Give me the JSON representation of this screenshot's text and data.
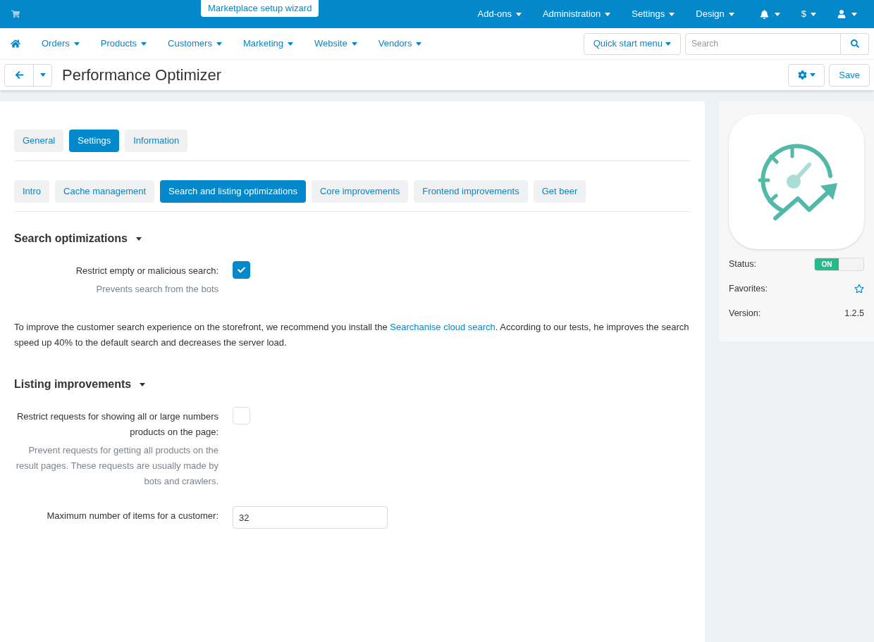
{
  "top_bar": {
    "wizard_button": "Marketplace setup wizard",
    "menus": [
      "Add-ons",
      "Administration",
      "Settings",
      "Design"
    ],
    "currency": "$"
  },
  "main_nav": {
    "items": [
      "Orders",
      "Products",
      "Customers",
      "Marketing",
      "Website",
      "Vendors"
    ],
    "quick_start": "Quick start menu",
    "search": {
      "placeholder": "Search"
    }
  },
  "toolbar": {
    "title": "Performance Optimizer",
    "save_button": "Save"
  },
  "tabs": [
    {
      "label": "General",
      "selected": false
    },
    {
      "label": "Settings",
      "selected": true
    },
    {
      "label": "Information",
      "selected": false
    }
  ],
  "subtabs": [
    {
      "label": "Intro",
      "selected": false
    },
    {
      "label": "Cache management",
      "selected": false
    },
    {
      "label": "Search and listing optimizations",
      "selected": true
    },
    {
      "label": "Core improvements",
      "selected": false
    },
    {
      "label": "Frontend improvements",
      "selected": false
    },
    {
      "label": "Get beer",
      "selected": false
    }
  ],
  "sections": [
    {
      "title": "Search optimizations",
      "fields": [
        {
          "kind": "checkbox",
          "label": "Restrict empty or malicious search:",
          "hint": "Prevents search from the bots",
          "checked": true
        }
      ],
      "note": {
        "before": "To improve the customer search experience on the storefront, we recommend you install the ",
        "link": "Searchanise cloud search",
        "after": ". According to our tests, he improves the search speed up 40% to the default search and decreases the server load."
      }
    },
    {
      "title": "Listing improvements",
      "fields": [
        {
          "kind": "checkbox",
          "label": "Restrict requests for showing all or large numbers products on the page:",
          "hint": "Prevent requests for getting all products on the result pages. These requests are usually made by bots and crawlers.",
          "checked": false
        },
        {
          "kind": "input",
          "label": "Maximum number of items for a customer:",
          "value": "32"
        }
      ]
    }
  ],
  "sidebar": {
    "status_label": "Status:",
    "status": {
      "text": "ON",
      "on": true
    },
    "favorites_label": "Favorites:",
    "version_label": "Version:",
    "version": "1.2.5"
  }
}
